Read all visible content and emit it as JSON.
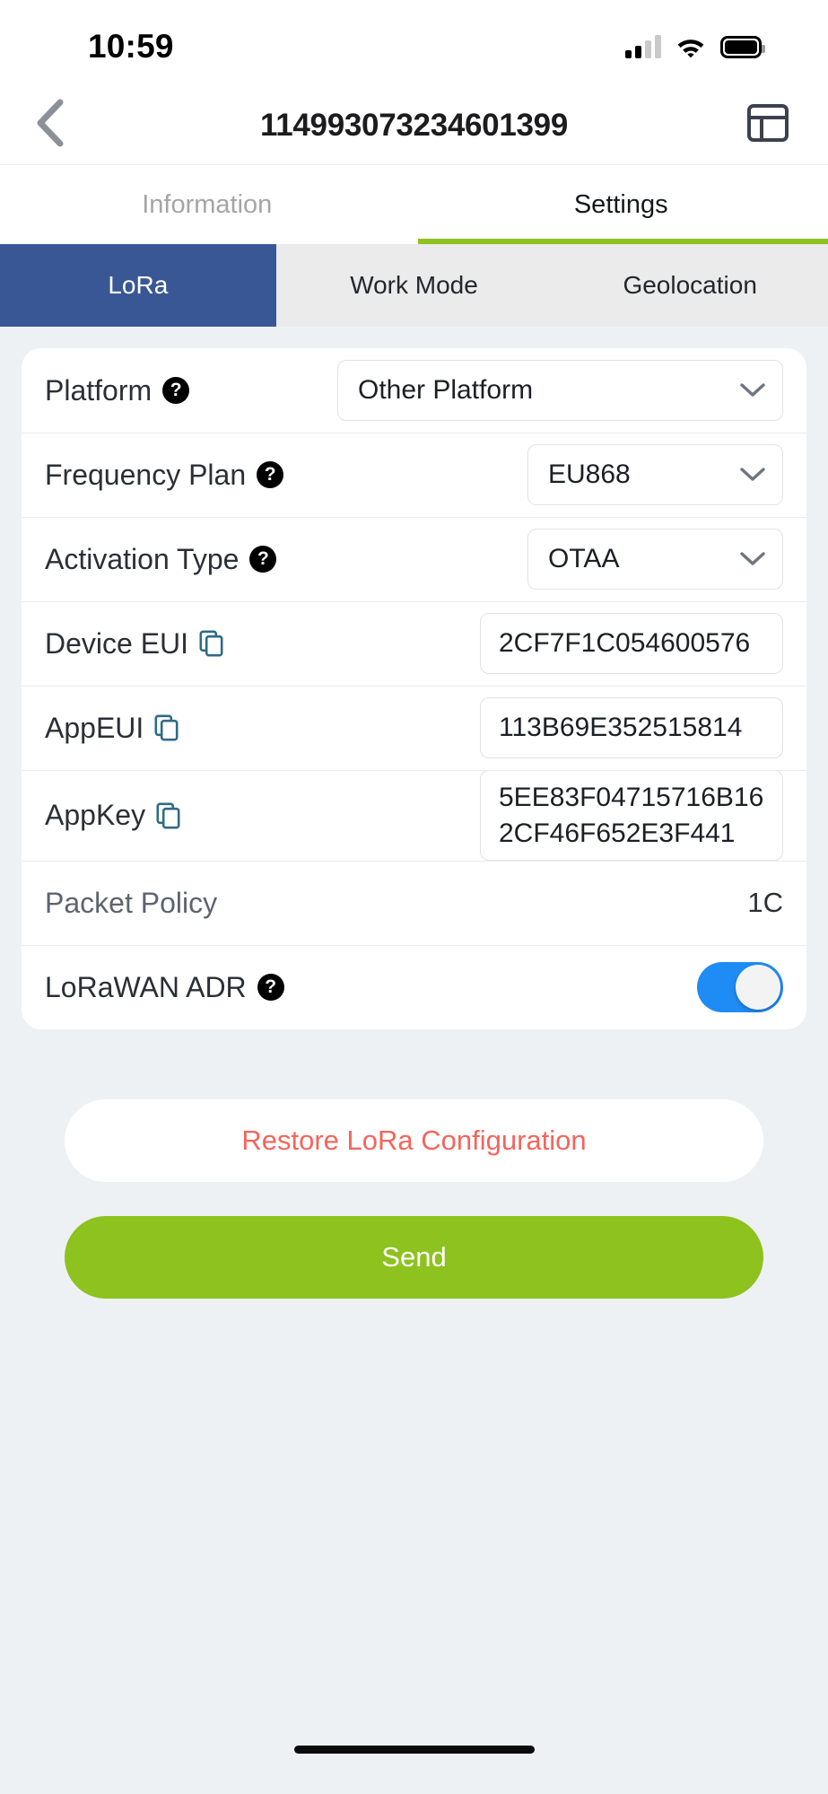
{
  "status_bar": {
    "time": "10:59",
    "signal_icon": "cellular-signal-icon",
    "wifi_icon": "wifi-icon",
    "battery_icon": "battery-icon"
  },
  "nav": {
    "back_icon": "chevron-left-icon",
    "title": "114993073234601399",
    "right_icon": "layout-panel-icon"
  },
  "tabs": [
    {
      "label": "Information",
      "active": false
    },
    {
      "label": "Settings",
      "active": true
    }
  ],
  "segments": [
    {
      "label": "LoRa",
      "active": true
    },
    {
      "label": "Work Mode",
      "active": false
    },
    {
      "label": "Geolocation",
      "active": false
    }
  ],
  "form": {
    "platform": {
      "label": "Platform",
      "help_glyph": "?",
      "value": "Other Platform",
      "chevron": "chevron-down-icon"
    },
    "frequency_plan": {
      "label": "Frequency Plan",
      "help_glyph": "?",
      "value": "EU868",
      "chevron": "chevron-down-icon"
    },
    "activation_type": {
      "label": "Activation Type",
      "help_glyph": "?",
      "value": "OTAA",
      "chevron": "chevron-down-icon"
    },
    "device_eui": {
      "label": "Device EUI",
      "copy_icon": "copy-icon",
      "value": "2CF7F1C054600576"
    },
    "app_eui": {
      "label": "AppEUI",
      "copy_icon": "copy-icon",
      "value": "113B69E352515814"
    },
    "app_key": {
      "label": "AppKey",
      "copy_icon": "copy-icon",
      "value": "5EE83F04715716B162CF46F652E3F441"
    },
    "packet_policy": {
      "label": "Packet Policy",
      "value": "1C"
    },
    "lorawan_adr": {
      "label": "LoRaWAN ADR",
      "help_glyph": "?",
      "enabled": true
    }
  },
  "actions": {
    "restore_label": "Restore LoRa Configuration",
    "send_label": "Send"
  },
  "colors": {
    "accent_green": "#8dc21f",
    "segment_active_blue": "#3a5795",
    "toggle_on_blue": "#1f8cf5",
    "restore_red": "#f4655c",
    "page_bg": "#eef1f4"
  }
}
